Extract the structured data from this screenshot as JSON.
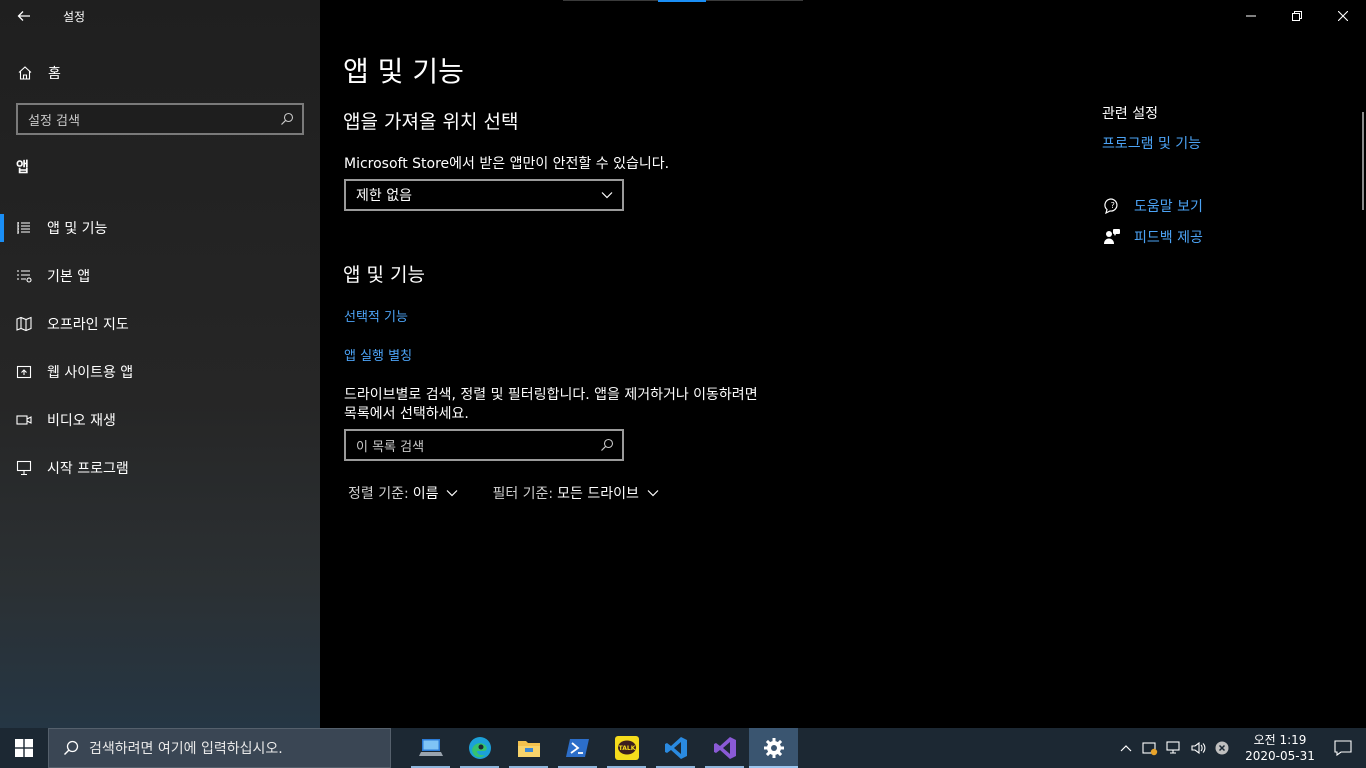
{
  "window": {
    "title": "설정",
    "controls": [
      "minimize-icon",
      "restore-icon",
      "close-icon"
    ]
  },
  "sidebar": {
    "home_label": "홈",
    "search_placeholder": "설정 검색",
    "section": "앱",
    "items": [
      {
        "label": "앱 및 기능",
        "icon": "apps-features-icon",
        "selected": true
      },
      {
        "label": "기본 앱",
        "icon": "default-apps-icon",
        "selected": false
      },
      {
        "label": "오프라인 지도",
        "icon": "offline-maps-icon",
        "selected": false
      },
      {
        "label": "웹 사이트용 앱",
        "icon": "apps-for-websites-icon",
        "selected": false
      },
      {
        "label": "비디오 재생",
        "icon": "video-playback-icon",
        "selected": false
      },
      {
        "label": "시작 프로그램",
        "icon": "startup-icon",
        "selected": false
      }
    ]
  },
  "main": {
    "page_title": "앱 및 기능",
    "install_section": {
      "heading": "앱을 가져올 위치 선택",
      "description": "Microsoft Store에서 받은 앱만이 안전할 수 있습니다.",
      "dropdown_value": "제한 없음"
    },
    "apps_section": {
      "heading": "앱 및 기능",
      "link_optional": "선택적 기능",
      "link_aliases": "앱 실행 별칭",
      "description_line1": "드라이브별로 검색, 정렬 및 필터링합니다. 앱을 제거하거나 이동하려면",
      "description_line2": "목록에서 선택하세요.",
      "search_placeholder": "이 목록 검색",
      "sort_label": "정렬 기준:",
      "sort_value": "이름",
      "filter_label": "필터 기준:",
      "filter_value": "모든 드라이브"
    },
    "related": {
      "heading": "관련 설정",
      "link": "프로그램 및 기능"
    },
    "help": {
      "get_help": "도움말 보기",
      "feedback": "피드백 제공"
    }
  },
  "taskbar": {
    "search_text": "검색하려면 여기에 입력하십시오.",
    "apps": [
      {
        "name": "this-pc-icon",
        "active": false
      },
      {
        "name": "edge-icon",
        "active": false
      },
      {
        "name": "file-explorer-icon",
        "active": false
      },
      {
        "name": "powershell-icon",
        "active": false
      },
      {
        "name": "kakaotalk-icon",
        "active": false
      },
      {
        "name": "vscode-icon",
        "active": false
      },
      {
        "name": "visual-studio-icon",
        "active": false
      },
      {
        "name": "settings-icon",
        "active": true
      }
    ],
    "kakaotalk_label": "TALK",
    "clock_time": "오전 1:19",
    "clock_date": "2020-05-31"
  },
  "colors": {
    "accent": "#1a8ef5",
    "link": "#4ca3f5",
    "sidebar_bg": "#1f1f1f",
    "main_bg": "#000000",
    "taskbar_bg": "#1c2833"
  }
}
